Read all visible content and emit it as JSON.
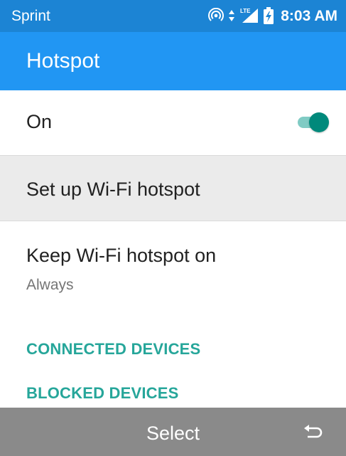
{
  "status_bar": {
    "carrier": "Sprint",
    "network_type": "LTE",
    "time": "8:03 AM",
    "icons": [
      "hotspot-icon",
      "data-arrows-icon",
      "lte-signal-icon",
      "battery-charging-icon"
    ]
  },
  "app_bar": {
    "title": "Hotspot",
    "background_color": "#2196F3"
  },
  "settings": {
    "toggle": {
      "label": "On",
      "state": true
    },
    "setup": {
      "label": "Set up Wi-Fi hotspot"
    },
    "keep_on": {
      "label": "Keep Wi-Fi hotspot on",
      "summary": "Always"
    }
  },
  "sections": {
    "connected": "CONNECTED DEVICES",
    "blocked": "BLOCKED DEVICES"
  },
  "softkeys": {
    "center_label": "Select",
    "right_icon": "back-icon"
  },
  "colors": {
    "status_bar": "#1C84D4",
    "accent": "#26A69A",
    "softkey_bar": "#8A8A8A",
    "selected_row": "#EBEBEB"
  }
}
